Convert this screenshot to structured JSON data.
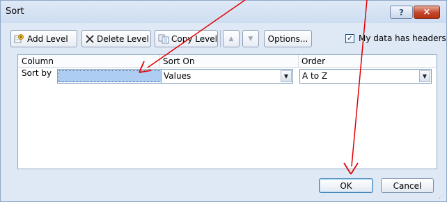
{
  "dialog": {
    "title": "Sort",
    "help_label": "?",
    "close_label": "×"
  },
  "toolbar": {
    "add_level": "Add Level",
    "delete_level": "Delete Level",
    "copy_level": "Copy Level",
    "move_up_glyph": "▲",
    "move_down_glyph": "▼",
    "options": "Options...",
    "my_data_headers": "My data has headers",
    "my_data_headers_checked": true,
    "check_glyph": "✓"
  },
  "grid": {
    "headers": {
      "column": "Column",
      "sort_on": "Sort On",
      "order": "Order"
    },
    "rows": [
      {
        "label": "Sort by",
        "column_value": "",
        "sort_on_value": "Values",
        "order_value": "A to Z"
      }
    ],
    "dropdown_glyph": "▼"
  },
  "footer": {
    "ok": "OK",
    "cancel": "Cancel",
    "grip_glyph": "⋰"
  },
  "annotation": {
    "arrow_color": "#e00000"
  },
  "colors": {
    "dialog_bg": "#dfe8f5",
    "selection_highlight": "#aecdf2",
    "close_button": "#c2462a"
  }
}
